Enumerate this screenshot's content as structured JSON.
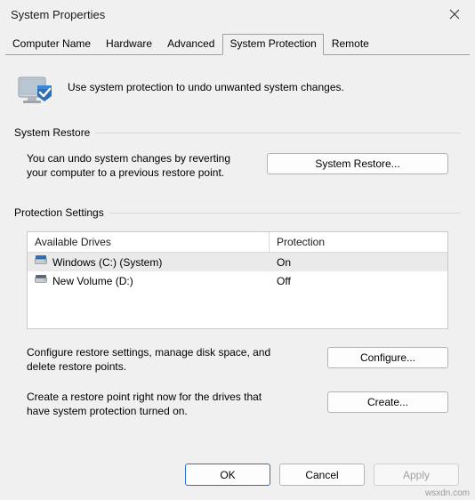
{
  "window": {
    "title": "System Properties",
    "close_icon": "close-icon"
  },
  "tabs": [
    {
      "label": "Computer Name",
      "active": false
    },
    {
      "label": "Hardware",
      "active": false
    },
    {
      "label": "Advanced",
      "active": false
    },
    {
      "label": "System Protection",
      "active": true
    },
    {
      "label": "Remote",
      "active": false
    }
  ],
  "intro": {
    "icon": "system-protection-icon",
    "text": "Use system protection to undo unwanted system changes."
  },
  "system_restore": {
    "group_label": "System Restore",
    "description_line1": "You can undo system changes by reverting",
    "description_line2": "your computer to a previous restore point.",
    "button_label": "System Restore..."
  },
  "protection_settings": {
    "group_label": "Protection Settings",
    "columns": [
      "Available Drives",
      "Protection"
    ],
    "drives": [
      {
        "icon": "windows-drive-icon",
        "name": "Windows (C:) (System)",
        "protection": "On",
        "selected": true
      },
      {
        "icon": "drive-icon",
        "name": "New Volume (D:)",
        "protection": "Off",
        "selected": false
      }
    ],
    "configure_text_line1": "Configure restore settings, manage disk space, and",
    "configure_text_line2": "delete restore points.",
    "configure_button": "Configure...",
    "create_text_line1": "Create a restore point right now for the drives that",
    "create_text_line2": "have system protection turned on.",
    "create_button": "Create..."
  },
  "footer": {
    "ok": "OK",
    "cancel": "Cancel",
    "apply": "Apply"
  },
  "watermark": "wsxdn.com",
  "colors": {
    "accent": "#2a6fd1",
    "window_bg": "#f0f0f0",
    "list_bg": "#ffffff",
    "selected_row": "#eaeaea"
  }
}
